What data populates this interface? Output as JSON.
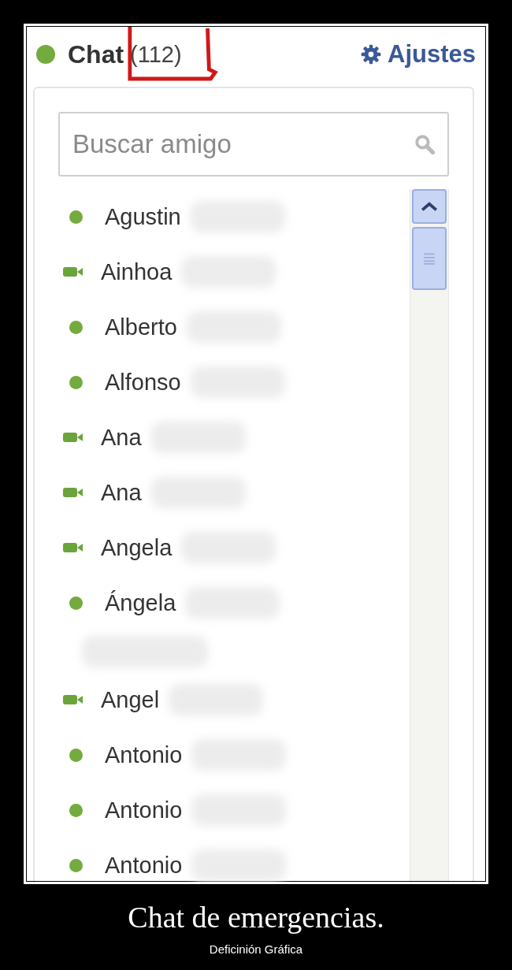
{
  "chat": {
    "title": "Chat",
    "count": "(112)",
    "online": true,
    "settings": "Ajustes",
    "search": {
      "placeholder": "Buscar amigo"
    },
    "friends": [
      {
        "name": "Agustin",
        "kind": "online"
      },
      {
        "name": "Ainhoa",
        "kind": "video"
      },
      {
        "name": "Alberto",
        "kind": "online"
      },
      {
        "name": "Alfonso",
        "kind": "online"
      },
      {
        "name": "Ana",
        "kind": "video"
      },
      {
        "name": "Ana",
        "kind": "video"
      },
      {
        "name": "Angela",
        "kind": "video"
      },
      {
        "name": "Ángela",
        "kind": "online"
      },
      {
        "kind": "blurred"
      },
      {
        "name": "Angel",
        "kind": "video"
      },
      {
        "name": "Antonio",
        "kind": "online"
      },
      {
        "name": "Antonio",
        "kind": "online"
      },
      {
        "name": "Antonio",
        "kind": "online"
      }
    ]
  },
  "caption": {
    "title": "Chat de emergencias.",
    "subtitle": "Deficinión Gráfica"
  }
}
